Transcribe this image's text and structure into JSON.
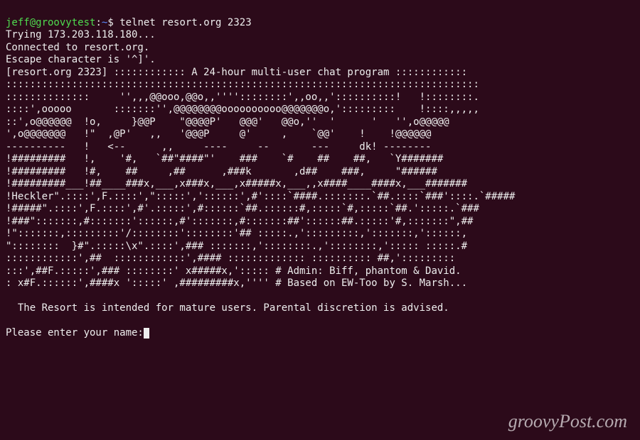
{
  "prompt": {
    "user": "jeff@groovytest",
    "sep": ":",
    "path": "~",
    "dollar": "$"
  },
  "command": "telnet resort.org 2323",
  "connect_lines": [
    "Trying 173.203.118.180...",
    "Connected to resort.org.",
    "Escape character is '^]'."
  ],
  "banner_header": "[resort.org 2323] :::::::::::: A 24-hour multi-user chat program ::::::::::::",
  "ascii_art": [
    ":::::::::::::::::::::::::::::::::::::::::::::::::::::::::::::::::::::::::::::::",
    "::::::::::::::     '',,,@@ooo,@@o,,''''::::::::',,oo,,'::::::::::!   !::::::::.",
    "::::',ooooo       :::::::'',@@@@@@@@oooooooooo@@@@@@@o,':::::::::    !::::,,,,,",
    "::',o@@@@@@  !o,     }@@P    \"@@@@P'   @@@'   @@o,''  '      '   '',o@@@@@",
    "',o@@@@@@@   !\"  ,@P'   ,,   '@@@P     @'     ,    `@@'    !    !@@@@@@",
    "----------   !   <--      ,,     ----     --       ---     dk! --------",
    "!#########   !,    '#,   `##\"####\"'    ###    `#    ##    ##,   `Y#######",
    "!#########   !#,    ##     ,##      ,###k       ,d##    ###,     \"######",
    "!#########___!##____###x,___,x###x,___,x#####x,___,,x####____####x,___#######",
    "!Heckler\".::::',F.::::',\":::::','::::::',#'::::`####.:::::::.`##.::::`###'::::.`#####",
    "!#####\".::::',F.::::',#'.:::::',#::::::`##.::::::#,:::::`#,:::::`##.':::::.`###",
    "!###\":::::::,#:::::::'::::::,#':::::::,#:::::::##'::::::##.:::::'#,:::::::\",##",
    "!\":::::::,:::::::::'/::::::::'::::::::'## :::::.,':::::::::,':::::::,'::::::,",
    "\"::::::::  }#\".:::::\\x\".::::',### :::::::,'::::::::.,'::::::::,'::::: :::::.#",
    "::::::::::::',##  ::::::::::::',#### ::::::::::::: :::::::::: ##,':::::::::",
    ":::',##F.:::::',### ::::::::' x#####x,'::::: # Admin: Biff, phantom & David.",
    ": x#F.::::::',####x ':::::' ,#########x,'''' # Based on EW-Too by S. Marsh..."
  ],
  "footer": {
    "disclaimer": "  The Resort is intended for mature users. Parental discretion is advised.",
    "name_prompt": "Please enter your name:"
  },
  "watermark": "groovyPost.com"
}
